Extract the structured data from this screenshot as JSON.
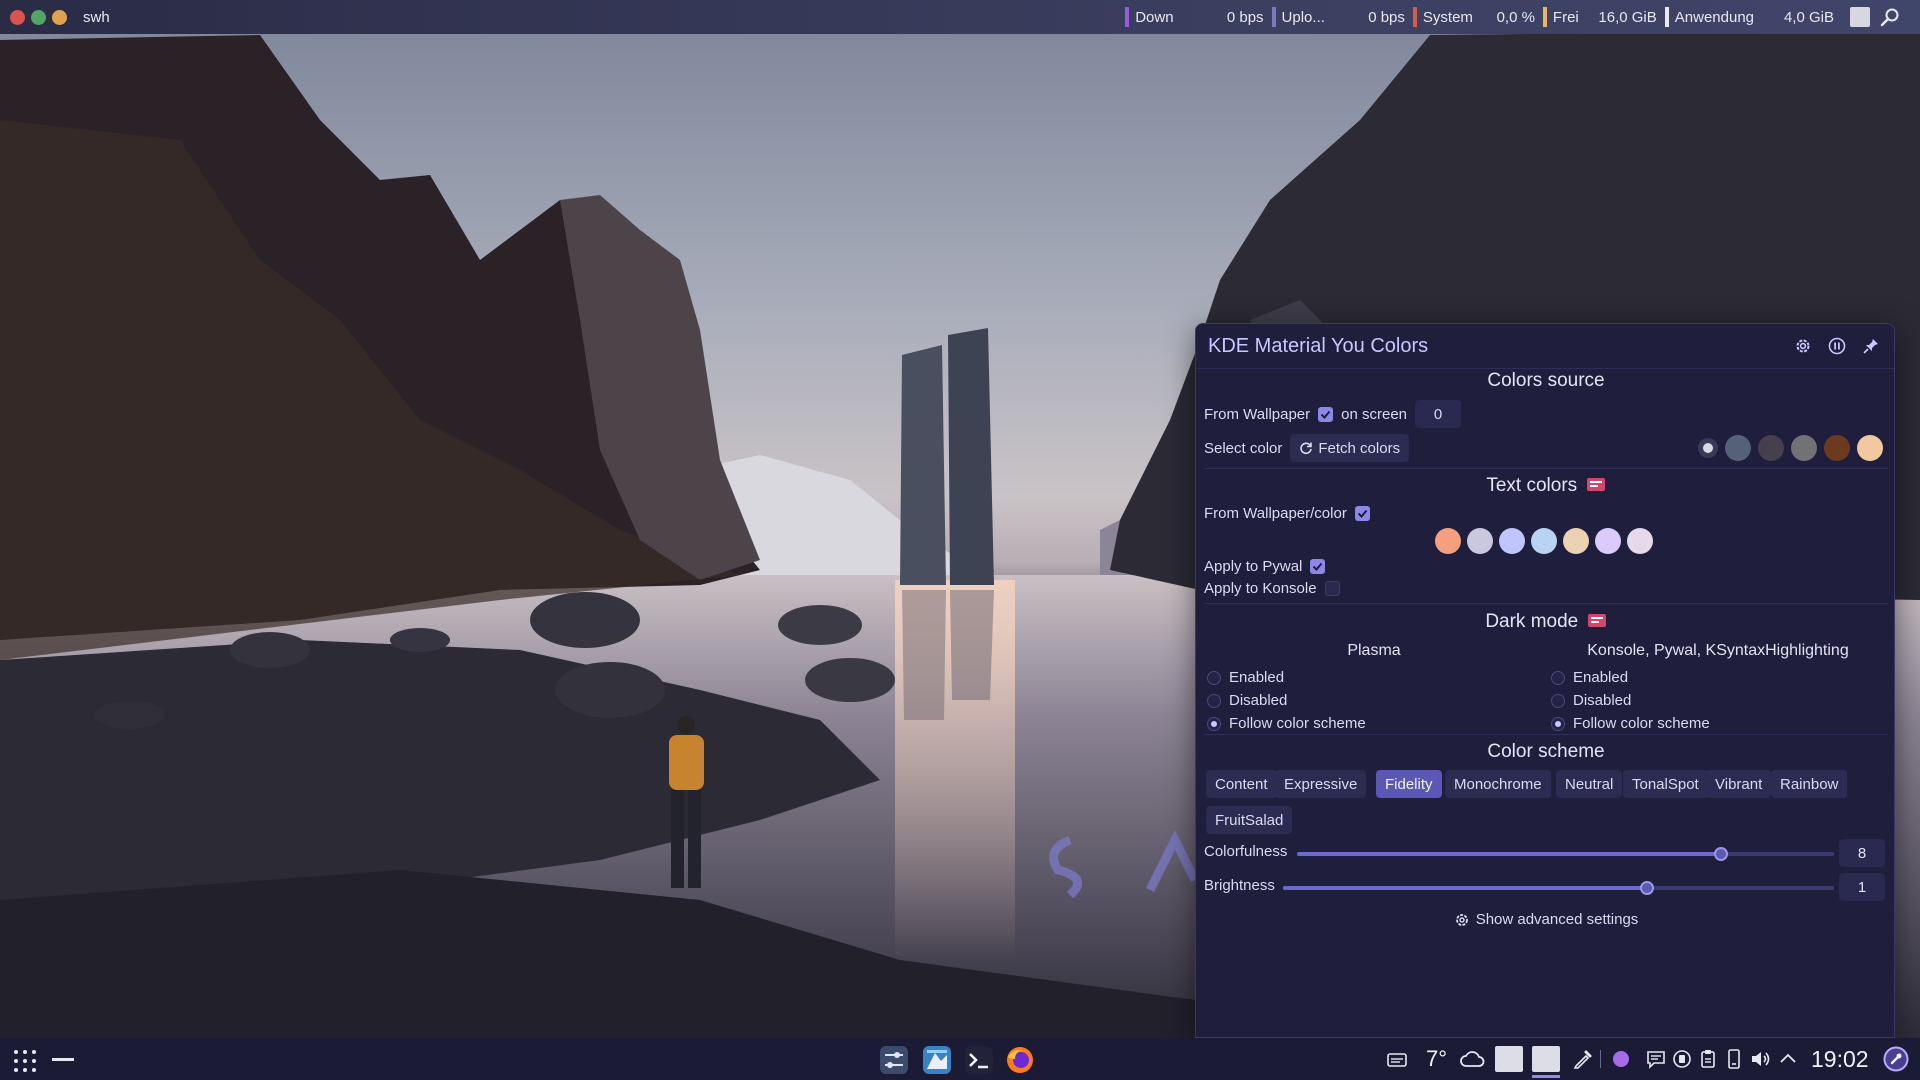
{
  "top_panel": {
    "app_title": "swh",
    "monitors": [
      {
        "label": "Down",
        "value": "0 bps"
      },
      {
        "label": "Uplo...",
        "value": "0 bps"
      },
      {
        "label": "System",
        "value": "0,0 %"
      },
      {
        "label": "Frei",
        "value": "16,0 GiB"
      },
      {
        "label": "Anwendung",
        "value": "4,0 GiB"
      }
    ]
  },
  "widget": {
    "title": "KDE Material You Colors",
    "colors_source": {
      "title": "Colors source",
      "from_wallpaper_label": "From Wallpaper",
      "from_wallpaper_checked": true,
      "on_screen_label": "on screen",
      "on_screen_value": "0",
      "select_color_label": "Select color",
      "fetch_colors_label": "Fetch colors",
      "wallpaper_colors": [
        "#d9d9e0",
        "#536276",
        "#46404e",
        "#727276",
        "#6b3a1f",
        "#f0c9a0"
      ]
    },
    "text_colors": {
      "title": "Text colors",
      "from_wallpaper_color_label": "From Wallpaper/color",
      "from_wallpaper_color_checked": true,
      "swatches": [
        "#f4a07e",
        "#c9c8df",
        "#bfc6fb",
        "#b9d4f2",
        "#ecd2b2",
        "#d9cbfa",
        "#e5d9ea"
      ],
      "apply_pywal_label": "Apply to Pywal",
      "apply_pywal_checked": true,
      "apply_konsole_label": "Apply to Konsole",
      "apply_konsole_checked": false
    },
    "dark_mode": {
      "title": "Dark mode",
      "plasma": {
        "title": "Plasma",
        "options": [
          "Enabled",
          "Disabled",
          "Follow color scheme"
        ],
        "selected": 2
      },
      "konsole": {
        "title": "Konsole, Pywal, KSyntaxHighlighting",
        "options": [
          "Enabled",
          "Disabled",
          "Follow color scheme"
        ],
        "selected": 2
      }
    },
    "color_scheme": {
      "title": "Color scheme",
      "options": [
        "Content",
        "Expressive",
        "Fidelity",
        "Monochrome",
        "Neutral",
        "TonalSpot",
        "Vibrant",
        "Rainbow",
        "FruitSalad"
      ],
      "selected": "Fidelity",
      "colorfulness_label": "Colorfulness",
      "colorfulness_value": "8",
      "colorfulness_fraction": 0.79,
      "brightness_label": "Brightness",
      "brightness_value": "1",
      "brightness_fraction": 0.66
    },
    "advanced_label": "Show advanced settings"
  },
  "bottom_panel": {
    "temperature": "7°",
    "clock": "19:02"
  },
  "colors": {
    "accent": "#8c88e8",
    "widget_bg": "#1f1e3d",
    "panel_bg": "#1c1b36"
  }
}
